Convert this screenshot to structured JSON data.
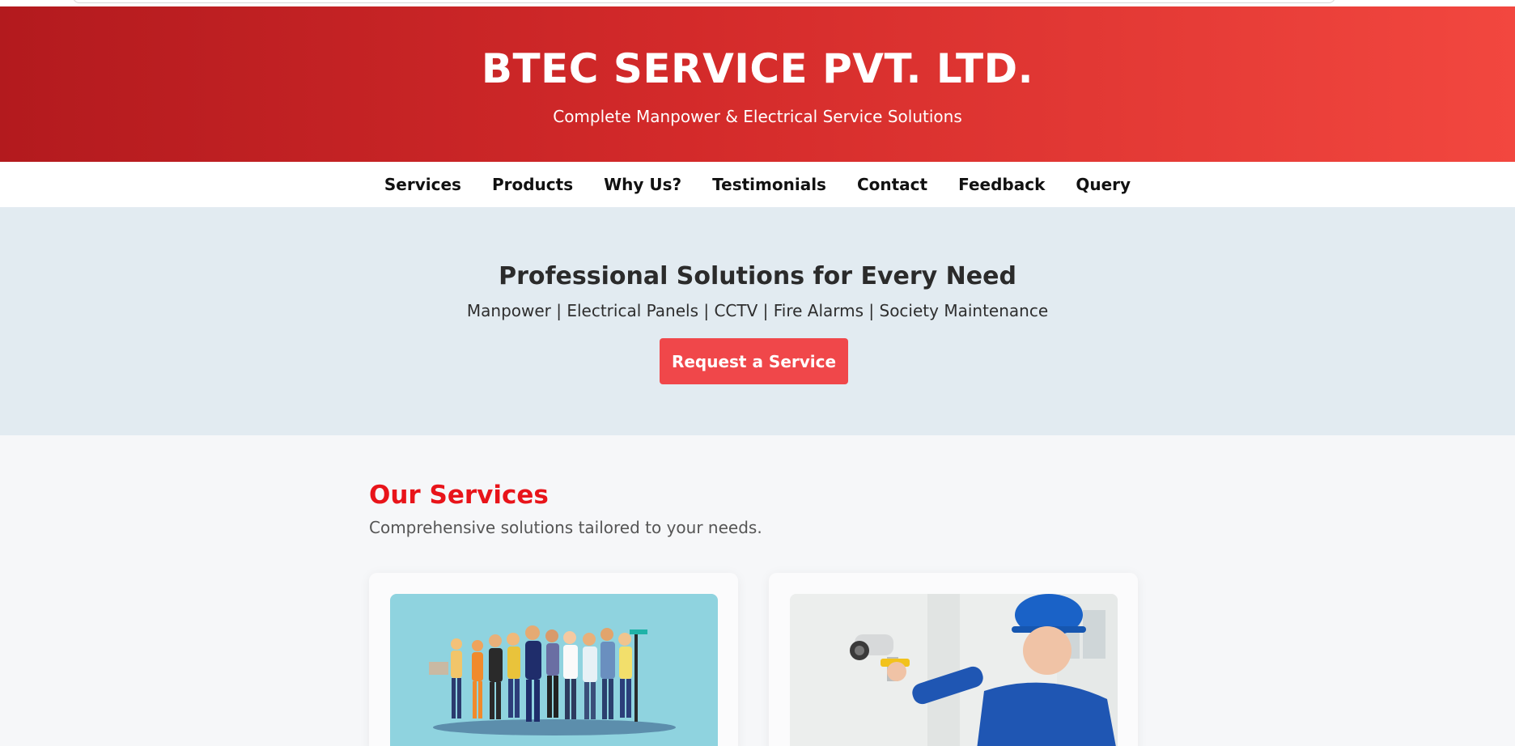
{
  "header": {
    "title": "BTEC SERVICE PVT. LTD.",
    "tagline": "Complete Manpower & Electrical Service Solutions"
  },
  "nav": {
    "items": [
      "Services",
      "Products",
      "Why Us?",
      "Testimonials",
      "Contact",
      "Feedback",
      "Query"
    ]
  },
  "hero": {
    "title": "Professional Solutions for Every Need",
    "subtitle": "Manpower | Electrical Panels | CCTV | Fire Alarms | Society Maintenance",
    "cta_label": "Request a Service"
  },
  "services": {
    "title": "Our Services",
    "lead": "Comprehensive solutions tailored to your needs.",
    "cards": [
      {
        "image_icon": "workforce-group-illustration"
      },
      {
        "image_icon": "cctv-technician-photo"
      }
    ]
  },
  "colors": {
    "brand_red": "#e8141a",
    "header_gradient_start": "#b31a1e",
    "header_gradient_end": "#f2473f",
    "cta": "#f0474a",
    "hero_bg": "#e2ebf1"
  }
}
